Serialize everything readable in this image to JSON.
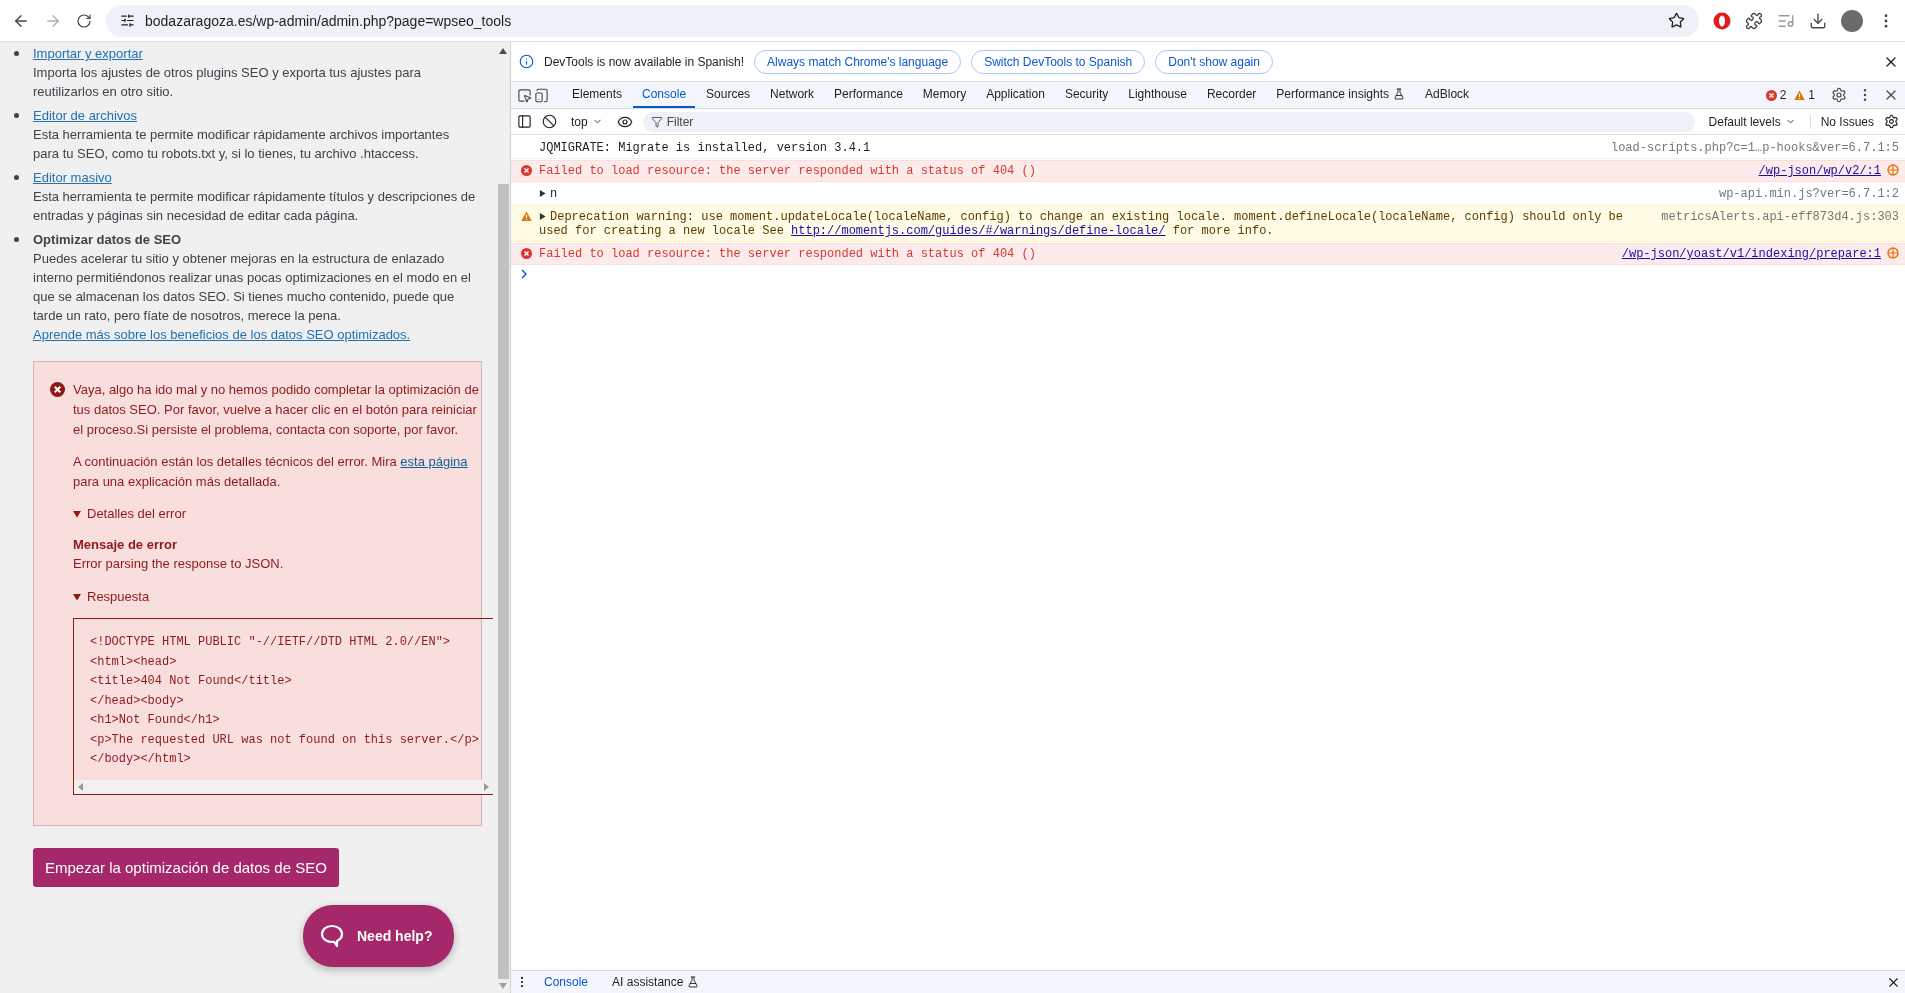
{
  "browser": {
    "url": "bodazaragoza.es/wp-admin/admin.php?page=wpseo_tools"
  },
  "page": {
    "tools": [
      {
        "kind": "link",
        "title": "Importar y exportar",
        "description": "Importa los ajustes de otros plugins SEO y exporta tus ajustes para reutilizarlos en otro sitio."
      },
      {
        "kind": "link",
        "title": "Editor de archivos",
        "description": "Esta herramienta te permite modificar rápidamente archivos importantes para tu SEO, como tu robots.txt y, si lo tienes, tu archivo .htaccess."
      },
      {
        "kind": "link",
        "title": "Editor masivo",
        "description": "Esta herramienta te permite modificar rápidamente títulos y descripciones de entradas y páginas sin necesidad de editar cada página."
      },
      {
        "kind": "heading",
        "title": "Optimizar datos de SEO",
        "description": "Puedes acelerar tu sitio y obtener mejoras en la estructura de enlazado interno permitiéndonos realizar unas pocas optimizaciones en el modo en el que se almacenan los datos SEO. Si tienes mucho contenido, puede que tarde un rato, pero fíate de nosotros, merece la pena. ",
        "link": "Aprende más sobre los beneficios de los datos SEO optimizados."
      }
    ],
    "error_alert": {
      "message": "Vaya, algo ha ido mal y no hemos podido completar la optimización de tus datos SEO. Por favor, vuelve a hacer clic en el botón para reiniciar el proceso.Si persiste el problema, contacta con soporte, por favor.",
      "details_before": "A continuación están los detalles técnicos del error. Mira ",
      "details_link": "esta página",
      "details_after": " para una explicación más detallada.",
      "sections": [
        {
          "summary": "Detalles del error",
          "expanded": true,
          "heading": "Mensaje de error",
          "text": "Error parsing the response to JSON."
        },
        {
          "summary": "Respuesta",
          "expanded": true,
          "code": [
            "<!DOCTYPE HTML PUBLIC \"-//IETF//DTD HTML 2.0//EN\">",
            "<html><head>",
            "<title>404 Not Found</title>",
            "</head><body>",
            "<h1>Not Found</h1>",
            "<p>The requested URL was not found on this server.</p>",
            "</body></html>"
          ]
        }
      ]
    },
    "start_button": "Empezar la optimización de datos de SEO",
    "help_button": "Need help?"
  },
  "devtools": {
    "infobar": {
      "message": "DevTools is now available in Spanish!",
      "buttons": [
        "Always match Chrome's language",
        "Switch DevTools to Spanish",
        "Don't show again"
      ]
    },
    "tabs": [
      {
        "label": "Elements",
        "selected": false,
        "experimental": false
      },
      {
        "label": "Console",
        "selected": true,
        "experimental": false
      },
      {
        "label": "Sources",
        "selected": false,
        "experimental": false
      },
      {
        "label": "Network",
        "selected": false,
        "experimental": false
      },
      {
        "label": "Performance",
        "selected": false,
        "experimental": false
      },
      {
        "label": "Memory",
        "selected": false,
        "experimental": false
      },
      {
        "label": "Application",
        "selected": false,
        "experimental": false
      },
      {
        "label": "Security",
        "selected": false,
        "experimental": false
      },
      {
        "label": "Lighthouse",
        "selected": false,
        "experimental": false
      },
      {
        "label": "Recorder",
        "selected": false,
        "experimental": false
      },
      {
        "label": "Performance insights",
        "selected": false,
        "experimental": true
      },
      {
        "label": "AdBlock",
        "selected": false,
        "experimental": false
      }
    ],
    "error_count": "2",
    "warning_count": "1",
    "console_toolbar": {
      "context": "top",
      "filter_placeholder": "Filter",
      "levels": "Default levels",
      "issues": "No Issues"
    },
    "messages": [
      {
        "kind": "log",
        "text": "JQMIGRATE: Migrate is installed, version 3.4.1",
        "source": "load-scripts.php?c=1…p-hooks&ver=6.7.1:5",
        "source_linked": false,
        "network": false
      },
      {
        "kind": "error",
        "text": "Failed to load resource: the server responded with a status of 404 ()",
        "source": "/wp-json/wp/v2/:1",
        "source_linked": true,
        "network": true
      },
      {
        "kind": "group",
        "expanded": false,
        "text": "n",
        "source": "wp-api.min.js?ver=6.7.1:2",
        "source_linked": false,
        "network": false
      },
      {
        "kind": "warning",
        "expanded": false,
        "text": "Deprecation warning: use moment.updateLocale(localeName, config) to change an existing locale. moment.defineLocale(localeName, config) should only be used for creating a new locale See ",
        "link": "http://momentjs.com/guides/#/warnings/define-locale/",
        "text_after": " for more info.",
        "source": "metricsAlerts.api-eff873d4.js:303",
        "source_linked": false,
        "network": false
      },
      {
        "kind": "error",
        "text": "Failed to load resource: the server responded with a status of 404 ()",
        "source": "/wp-json/yoast/v1/indexing/prepare:1",
        "source_linked": true,
        "network": true
      }
    ],
    "drawer_tabs": [
      {
        "label": "Console",
        "selected": true,
        "experimental": false
      },
      {
        "label": "AI assistance",
        "selected": false,
        "experimental": true
      }
    ]
  }
}
